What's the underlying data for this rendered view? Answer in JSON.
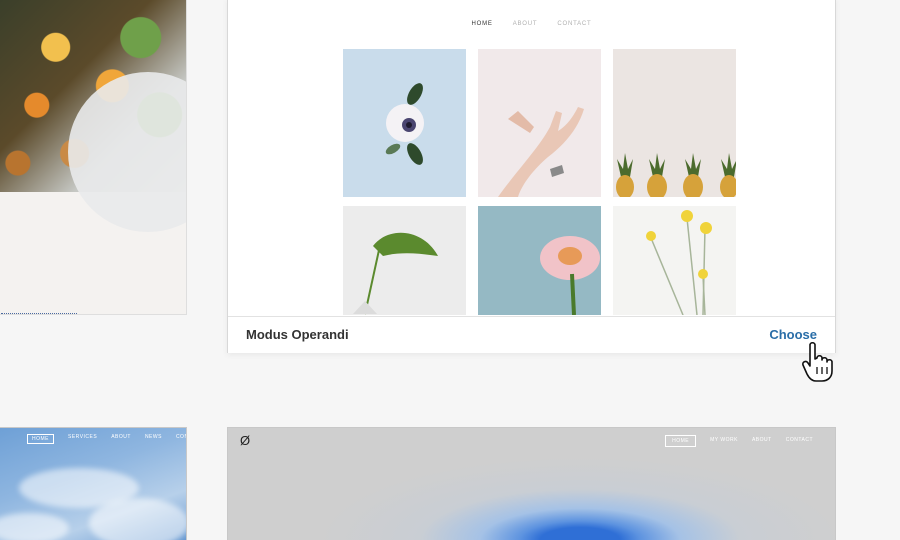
{
  "featured_theme": {
    "name": "Modus Operandi",
    "choose_label": "Choose",
    "nav": [
      "HOME",
      "ABOUT",
      "CONTACT"
    ],
    "active_nav": "HOME"
  },
  "bottom_left_theme": {
    "nav": [
      "HOME",
      "SERVICES",
      "ABOUT",
      "NEWS",
      "CONTACT"
    ]
  },
  "bottom_right_theme": {
    "logo": "Ø",
    "nav": [
      "HOME",
      "MY WORK",
      "ABOUT",
      "CONTACT"
    ]
  },
  "colors": {
    "accent": "#2a6ea8",
    "background": "#f6f6f6"
  }
}
